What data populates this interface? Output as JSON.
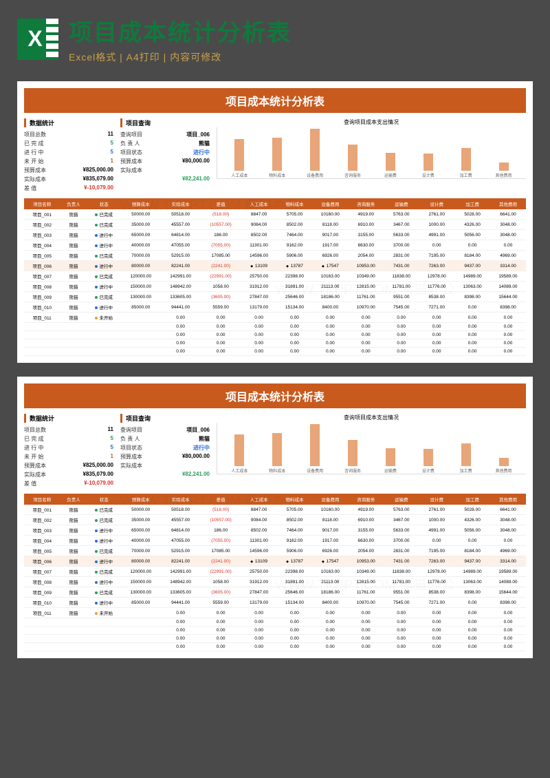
{
  "header": {
    "title": "项目成本统计分析表",
    "subtitle": "Excel格式 | A4打印 | 内容可修改",
    "icon_letter": "X"
  },
  "page_title": "项目成本统计分析表",
  "stats_block1_title": "数据统计",
  "stats_block2_title": "项目查询",
  "stats1": [
    {
      "label": "项目总数",
      "value": "11",
      "cls": ""
    },
    {
      "label": "已 完 成",
      "value": "5",
      "cls": "green"
    },
    {
      "label": "进 行 中",
      "value": "5",
      "cls": "blue"
    },
    {
      "label": "未 开 始",
      "value": "1",
      "cls": "orange"
    },
    {
      "label": "预算成本",
      "value": "¥825,000.00",
      "cls": ""
    },
    {
      "label": "实际成本",
      "value": "¥835,079.00",
      "cls": ""
    },
    {
      "label": "差  值",
      "value": "¥-10,079.00",
      "cls": "red"
    }
  ],
  "stats2": [
    {
      "label": "查询项目",
      "value": "项目_006",
      "cls": ""
    },
    {
      "label": "负 责 人",
      "value": "熊猫",
      "cls": ""
    },
    {
      "label": "项目状态",
      "value": "进行中",
      "cls": "blue"
    },
    {
      "label": "预算成本",
      "value": "¥80,000.00",
      "cls": ""
    },
    {
      "label": "实际成本",
      "value": "",
      "cls": ""
    },
    {
      "label": "",
      "value": "¥82,241.00",
      "cls": "green"
    }
  ],
  "chart_data": {
    "type": "bar",
    "title": "查询项目成本支出情况",
    "categories": [
      "人工成本",
      "物料成本",
      "设备费用",
      "咨询服务",
      "运输费",
      "设计费",
      "加工费",
      "其他费用"
    ],
    "values": [
      13109,
      13787,
      17547,
      10953,
      7431,
      7263,
      9437,
      3314
    ],
    "ylim": [
      0,
      20000
    ],
    "yticks": [
      "20000.00",
      "18000.00",
      "16000.00",
      "14000.00",
      "12000.00",
      "10000.00",
      "8000.00",
      "6000.00",
      "4000.00",
      "2000.00",
      "0.00"
    ]
  },
  "table_headers": [
    "项目名称",
    "负责人",
    "状态",
    "预算成本",
    "实际成本",
    "差值",
    "人工成本",
    "物料成本",
    "设备费用",
    "咨询服务",
    "运输费",
    "设计费",
    "加工费",
    "其他费用"
  ],
  "table_rows": [
    {
      "name": "项目_001",
      "owner": "熊猫",
      "status": "已完成",
      "dot": "green",
      "budget": "50000.00",
      "actual": "50518.00",
      "diff": "(518.00)",
      "c": [
        "8847.00",
        "5705.00",
        "10160.00",
        "4919.00",
        "5763.00",
        "2761.00",
        "5028.00",
        "6641.00"
      ]
    },
    {
      "name": "项目_002",
      "owner": "熊猫",
      "status": "已完成",
      "dot": "green",
      "budget": "35000.00",
      "actual": "45557.00",
      "diff": "(10557.00)",
      "c": [
        "9084.00",
        "8502.00",
        "8118.00",
        "6910.00",
        "3467.00",
        "1000.00",
        "4326.00",
        "3048.00"
      ]
    },
    {
      "name": "项目_003",
      "owner": "熊猫",
      "status": "进行中",
      "dot": "blue",
      "budget": "65000.00",
      "actual": "64814.00",
      "diff": "186.00",
      "c": [
        "8502.00",
        "7464.00",
        "9017.00",
        "3155.00",
        "5633.00",
        "4991.00",
        "5056.00",
        "3048.00"
      ]
    },
    {
      "name": "项目_004",
      "owner": "熊猫",
      "status": "进行中",
      "dot": "blue",
      "budget": "40000.00",
      "actual": "47055.00",
      "diff": "(7055.00)",
      "c": [
        "11301.00",
        "9162.00",
        "1917.00",
        "6630.00",
        "3700.00",
        "0.00",
        "0.00",
        "0.00"
      ]
    },
    {
      "name": "项目_005",
      "owner": "熊猫",
      "status": "已完成",
      "dot": "green",
      "budget": "70000.00",
      "actual": "52915.00",
      "diff": "17085.00",
      "c": [
        "14596.00",
        "5906.00",
        "6926.00",
        "2054.00",
        "2831.00",
        "7195.00",
        "8184.00",
        "4969.00"
      ]
    },
    {
      "name": "项目_006",
      "owner": "熊猫",
      "status": "进行中",
      "dot": "blue",
      "budget": "80000.00",
      "actual": "82241.00",
      "diff": "(2241.00)",
      "c": [
        "13109",
        "13787",
        "17547",
        "10953.00",
        "7431.00",
        "7263.00",
        "9437.00",
        "3314.00"
      ],
      "hl": true,
      "icons": true
    },
    {
      "name": "项目_007",
      "owner": "熊猫",
      "status": "已完成",
      "dot": "green",
      "budget": "120000.00",
      "actual": "142991.00",
      "diff": "(22991.00)",
      "c": [
        "25750.00",
        "22398.00",
        "10163.00",
        "10349.00",
        "11838.00",
        "12978.00",
        "14989.00",
        "19589.00"
      ]
    },
    {
      "name": "项目_008",
      "owner": "熊猫",
      "status": "进行中",
      "dot": "blue",
      "budget": "150000.00",
      "actual": "148942.00",
      "diff": "1058.00",
      "c": [
        "31912.00",
        "31891.00",
        "21113.00",
        "12815.00",
        "11781.00",
        "11776.00",
        "13063.00",
        "14089.00"
      ]
    },
    {
      "name": "项目_009",
      "owner": "熊猫",
      "status": "已完成",
      "dot": "green",
      "budget": "130000.00",
      "actual": "133605.00",
      "diff": "(3605.00)",
      "c": [
        "27847.00",
        "25646.00",
        "18186.00",
        "11761.00",
        "9551.00",
        "8538.00",
        "8398.00",
        "15644.00"
      ]
    },
    {
      "name": "项目_010",
      "owner": "熊猫",
      "status": "进行中",
      "dot": "blue",
      "budget": "85000.00",
      "actual": "94441.00",
      "diff": "5559.00",
      "c": [
        "13179.00",
        "15134.00",
        "8400.00",
        "10970.00",
        "7545.00",
        "7271.00",
        "0.00",
        "8398.00"
      ]
    },
    {
      "name": "项目_011",
      "owner": "熊猫",
      "status": "未开始",
      "dot": "orange",
      "budget": "",
      "actual": "0.00",
      "diff": "0.00",
      "c": [
        "0.00",
        "0.00",
        "0.00",
        "0.00",
        "0.00",
        "0.00",
        "0.00",
        "0.00"
      ]
    },
    {
      "name": "",
      "owner": "",
      "status": "",
      "dot": "",
      "budget": "",
      "actual": "0.00",
      "diff": "0.00",
      "c": [
        "0.00",
        "0.00",
        "0.00",
        "0.00",
        "0.00",
        "0.00",
        "0.00",
        "0.00"
      ]
    },
    {
      "name": "",
      "owner": "",
      "status": "",
      "dot": "",
      "budget": "",
      "actual": "0.00",
      "diff": "0.00",
      "c": [
        "0.00",
        "0.00",
        "0.00",
        "0.00",
        "0.00",
        "0.00",
        "0.00",
        "0.00"
      ]
    },
    {
      "name": "",
      "owner": "",
      "status": "",
      "dot": "",
      "budget": "",
      "actual": "0.00",
      "diff": "0.00",
      "c": [
        "0.00",
        "0.00",
        "0.00",
        "0.00",
        "0.00",
        "0.00",
        "0.00",
        "0.00"
      ]
    },
    {
      "name": "",
      "owner": "",
      "status": "",
      "dot": "",
      "budget": "",
      "actual": "0.00",
      "diff": "0.00",
      "c": [
        "0.00",
        "0.00",
        "0.00",
        "0.00",
        "0.00",
        "0.00",
        "0.00",
        "0.00"
      ]
    }
  ],
  "watermark_text": "WWW.TKPPT.COM 熊猫办公"
}
